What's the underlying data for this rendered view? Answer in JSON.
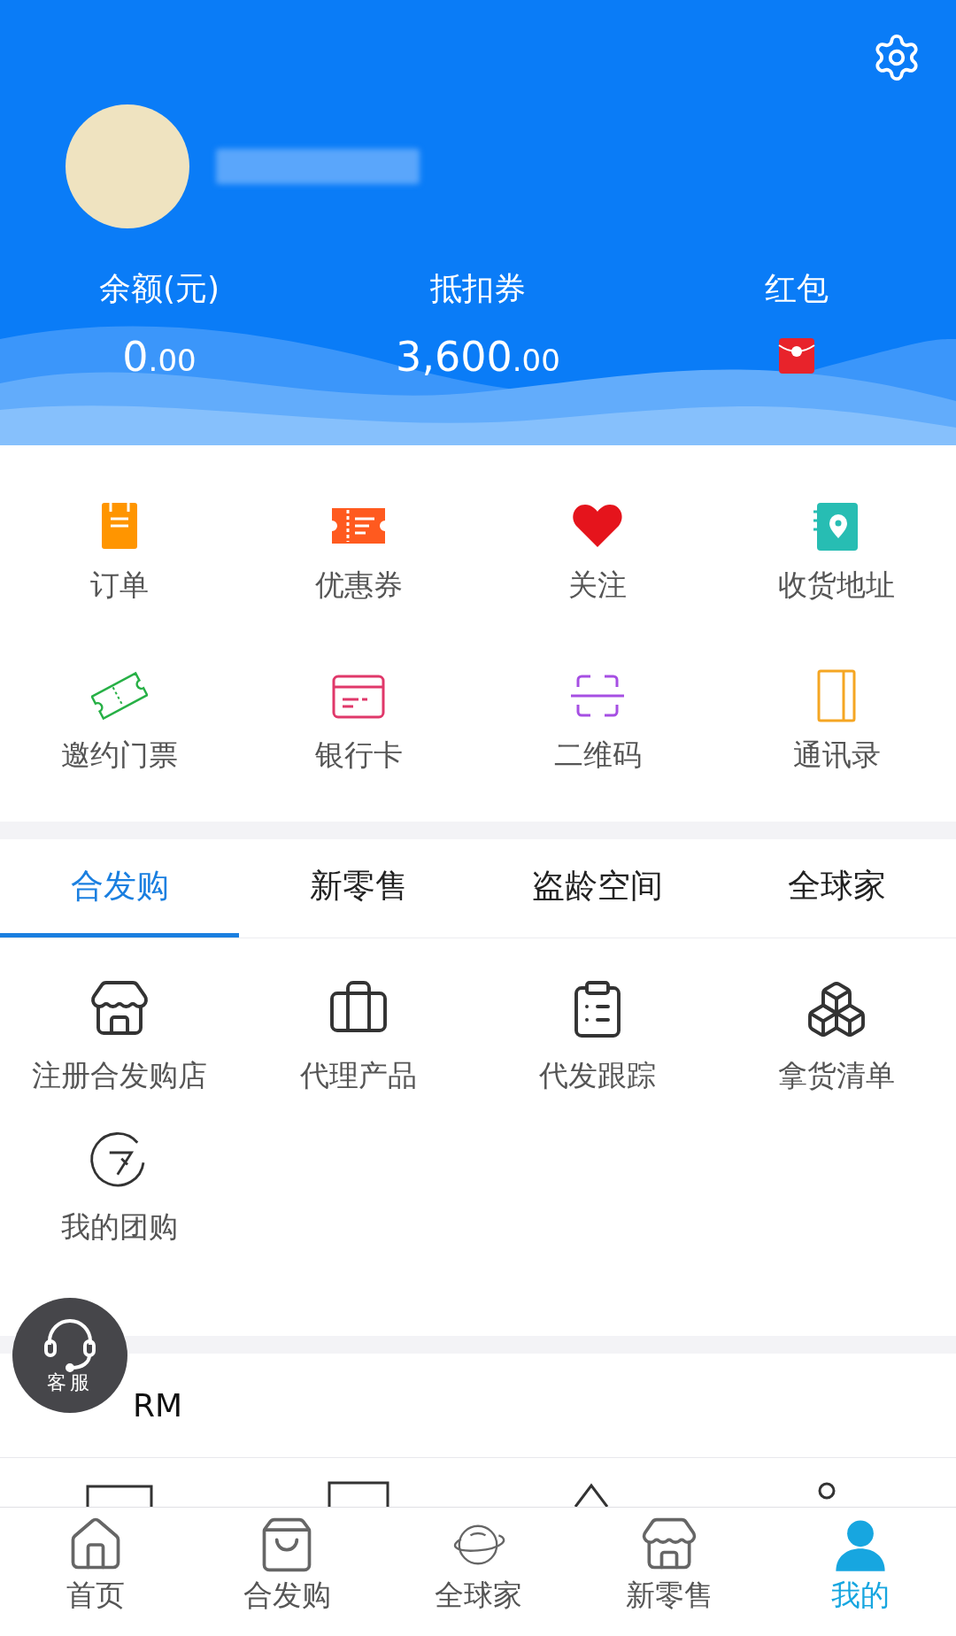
{
  "header": {
    "stats": [
      {
        "label": "余额(元)",
        "kind": "amount",
        "value": "0",
        "fraction": ".00"
      },
      {
        "label": "抵扣券",
        "kind": "amount",
        "value": "3,600",
        "fraction": ".00"
      },
      {
        "label": "红包",
        "kind": "icon"
      }
    ]
  },
  "quick_menu": [
    {
      "label": "订单"
    },
    {
      "label": "优惠券"
    },
    {
      "label": "关注"
    },
    {
      "label": "收货地址"
    },
    {
      "label": "邀约门票"
    },
    {
      "label": "银行卡"
    },
    {
      "label": "二维码"
    },
    {
      "label": "通讯录"
    }
  ],
  "tabs": [
    {
      "label": "合发购",
      "selected": true
    },
    {
      "label": "新零售",
      "selected": false
    },
    {
      "label": "盗龄空间",
      "selected": false
    },
    {
      "label": "全球家",
      "selected": false
    }
  ],
  "tab_items": [
    {
      "label": "注册合发购店"
    },
    {
      "label": "代理产品"
    },
    {
      "label": "代发跟踪"
    },
    {
      "label": "拿货清单"
    },
    {
      "label": "我的团购"
    }
  ],
  "crm": {
    "text": "RM"
  },
  "floating_button": {
    "label": "客服"
  },
  "bottom_nav": [
    {
      "label": "首页",
      "selected": false
    },
    {
      "label": "合发购",
      "selected": false
    },
    {
      "label": "全球家",
      "selected": false
    },
    {
      "label": "新零售",
      "selected": false
    },
    {
      "label": "我的",
      "selected": true
    }
  ]
}
